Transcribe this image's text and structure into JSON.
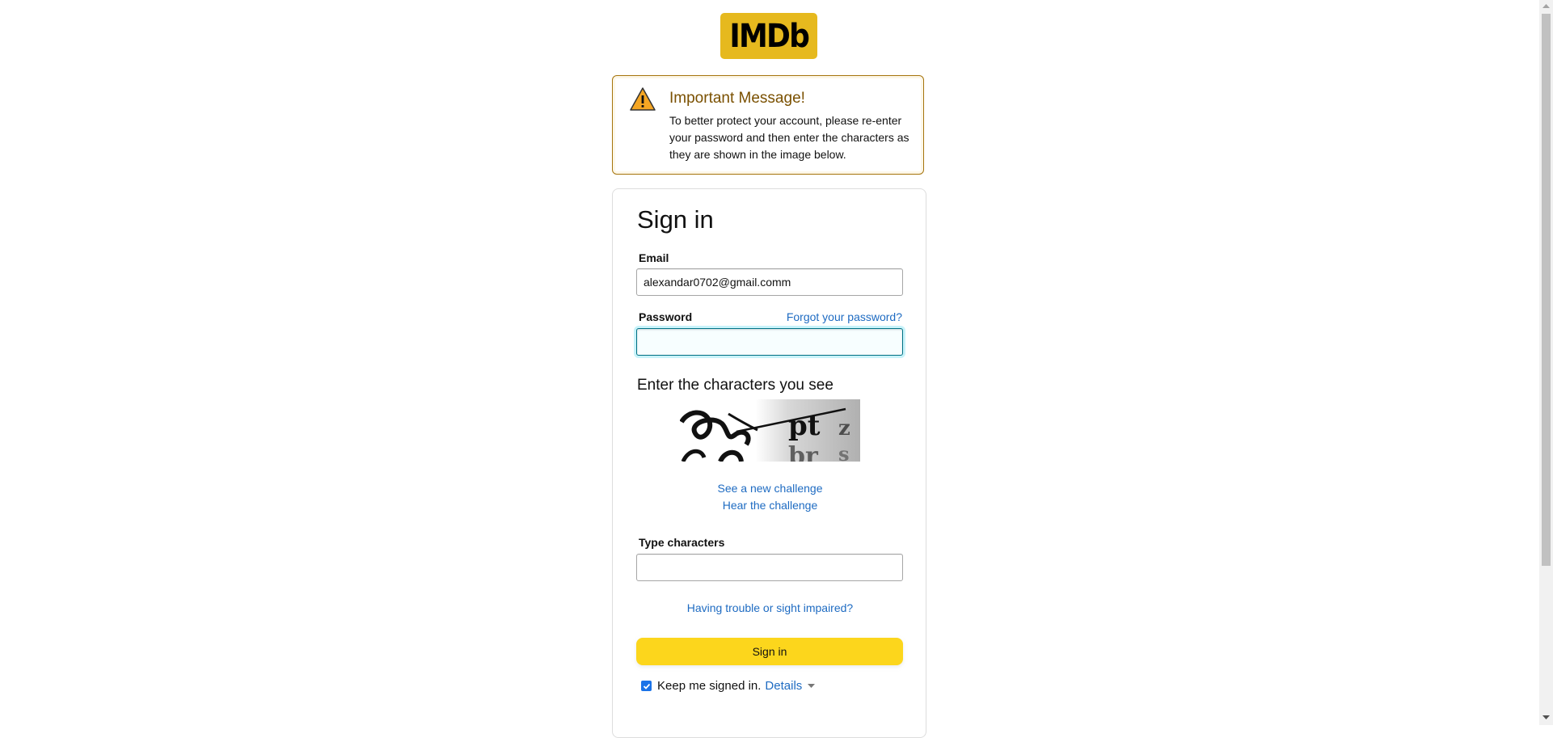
{
  "logo": {
    "text": "IMDb"
  },
  "alert": {
    "title": "Important Message!",
    "body": "To better protect your account, please re-enter your password and then enter the characters as they are shown in the image below.",
    "icon": "warning-icon"
  },
  "signin": {
    "heading": "Sign in",
    "email_label": "Email",
    "email_value": "alexandar0702@gmail.comm",
    "password_label": "Password",
    "forgot_link": "Forgot your password?",
    "password_value": "",
    "captcha_heading": "Enter the characters you see",
    "new_challenge_link": "See a new challenge",
    "hear_challenge_link": "Hear the challenge",
    "type_label": "Type characters",
    "type_value": "",
    "trouble_link": "Having trouble or sight impaired?",
    "button_label": "Sign in",
    "keep_label": "Keep me signed in.",
    "details_link": "Details",
    "keep_checked": true
  },
  "colors": {
    "brand": "#e6b91e",
    "button": "#fcd61c",
    "link": "#1e6bc2",
    "alert_border": "#a6740c"
  }
}
